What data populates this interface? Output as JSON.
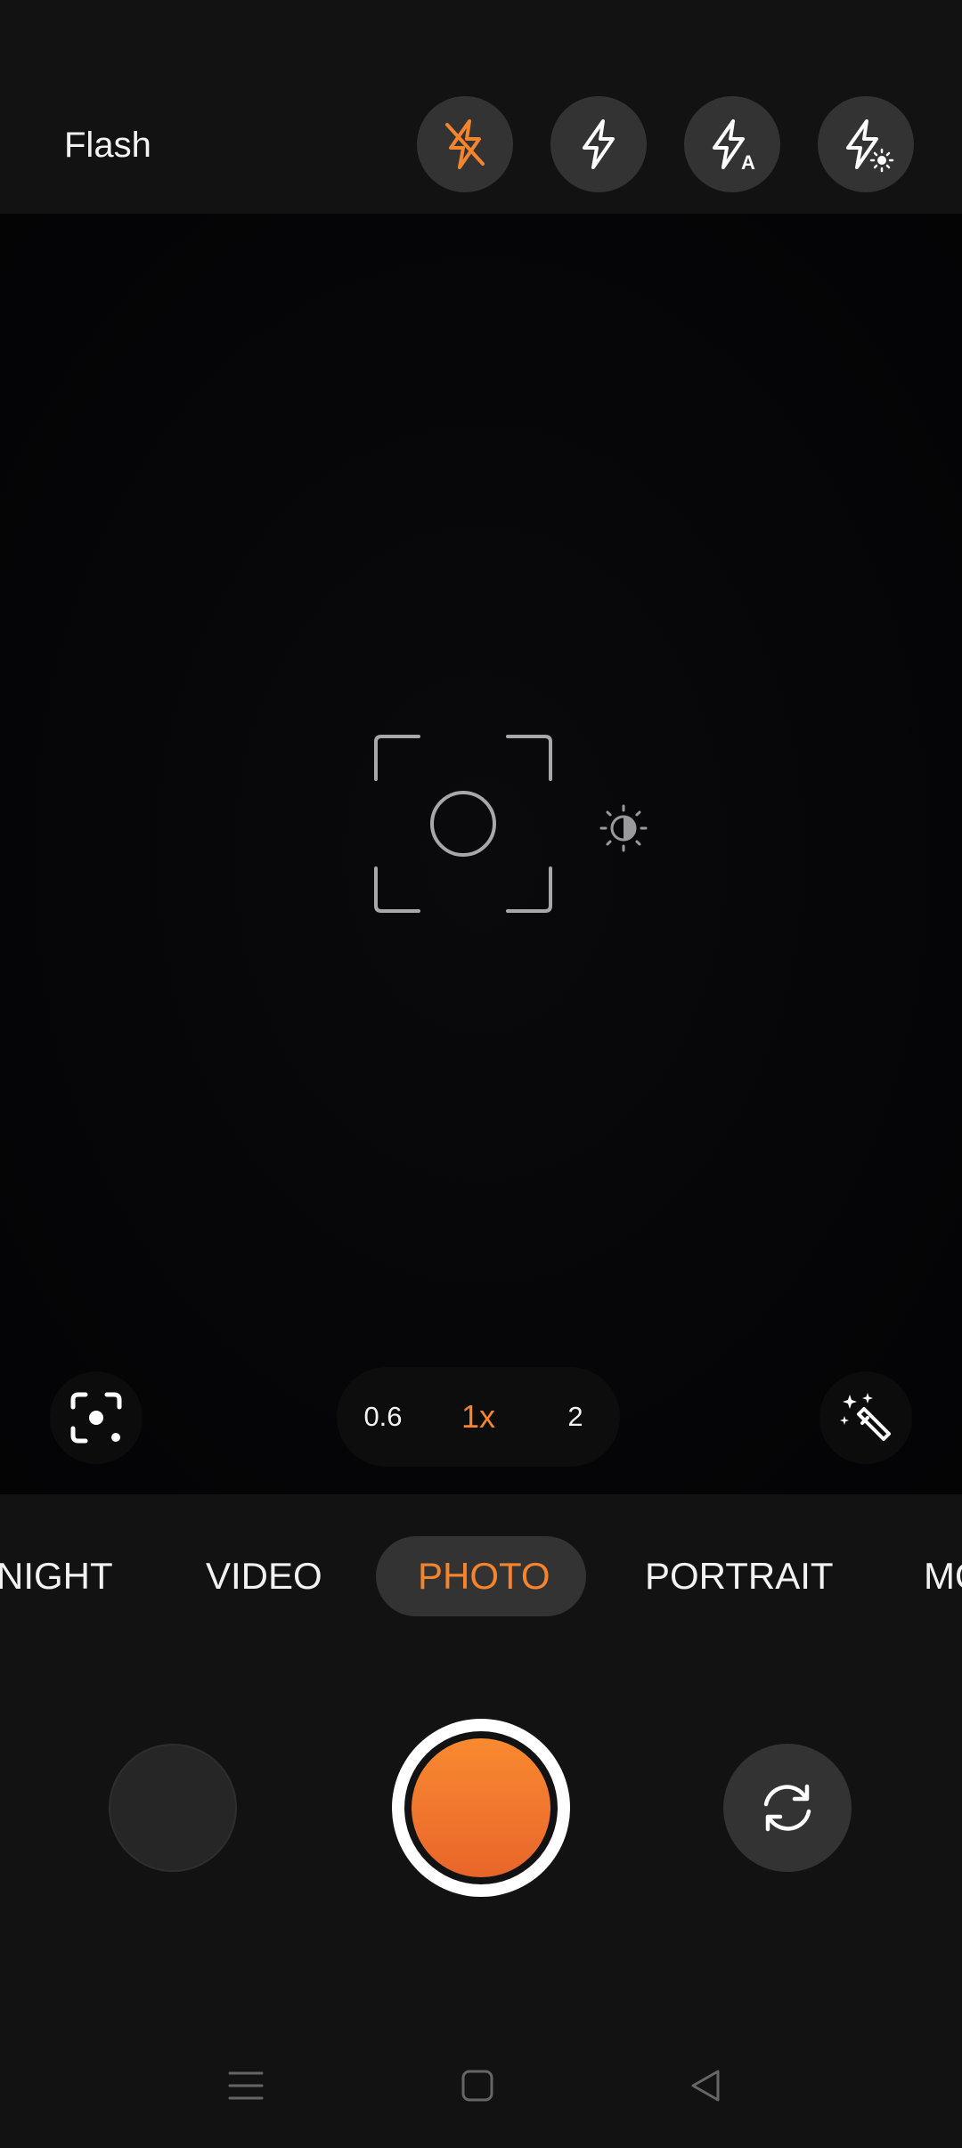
{
  "flash": {
    "label": "Flash",
    "options": [
      {
        "icon": "flash-off-icon",
        "selected": true
      },
      {
        "icon": "flash-on-icon",
        "selected": false
      },
      {
        "icon": "flash-auto-icon",
        "selected": false,
        "badge": "A"
      },
      {
        "icon": "flash-torch-icon",
        "selected": false
      }
    ]
  },
  "viewfinder": {
    "focus_icon": "focus-frame-icon",
    "exposure_icon": "exposure-icon"
  },
  "controls": {
    "lens_icon": "lens-focus-icon",
    "magic_icon": "magic-wand-icon",
    "zoom": {
      "options": [
        "0.6",
        "1x",
        "2"
      ],
      "selected": "1x"
    }
  },
  "modes": {
    "items": [
      "NIGHT",
      "VIDEO",
      "PHOTO",
      "PORTRAIT",
      "MO"
    ],
    "selected": "PHOTO"
  },
  "shutter_row": {
    "gallery_icon": "gallery-thumbnail",
    "shutter_icon": "shutter-button",
    "flip_icon": "switch-camera-icon"
  },
  "system_nav": {
    "icons": [
      "recents-icon",
      "home-icon",
      "back-icon"
    ]
  },
  "colors": {
    "accent": "#f5842c",
    "background": "#121212",
    "button": "#333333",
    "viewfinder": "#050507"
  }
}
